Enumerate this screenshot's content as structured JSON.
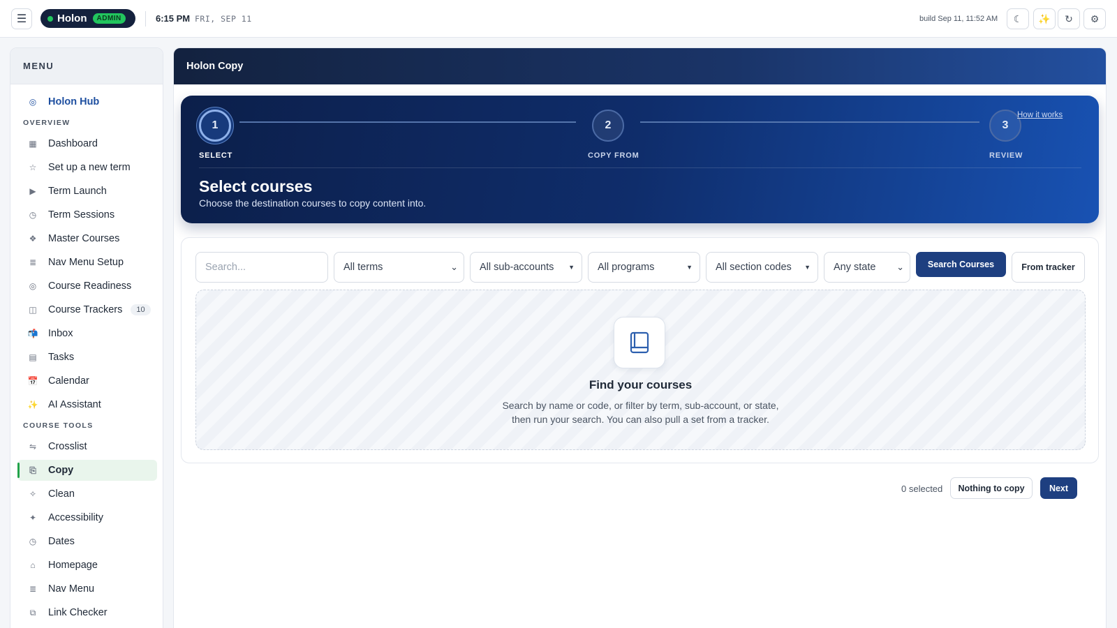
{
  "topbar": {
    "menu_icon": "hamburger-icon",
    "brand": "Holon",
    "badge": "ADMIN",
    "time": "6:15 PM",
    "date": "FRI, SEP 11",
    "build": "build Sep 11, 11:52 AM",
    "theme_icon": "☾",
    "sparkle_icon": "✨",
    "refresh_icon": "↻",
    "settings_icon": "⚙"
  },
  "sidebar": {
    "heading": "MENU",
    "hub": {
      "icon": "◎",
      "label": "Holon Hub"
    },
    "overview_label": "OVERVIEW",
    "overview": [
      {
        "icon": "▦",
        "label": "Dashboard"
      },
      {
        "icon": "☆",
        "label": "Set up a new term"
      },
      {
        "icon": "▶",
        "label": "Term Launch"
      },
      {
        "icon": "◷",
        "label": "Term Sessions"
      },
      {
        "icon": "❖",
        "label": "Master Courses"
      },
      {
        "icon": "≣",
        "label": "Nav Menu Setup"
      },
      {
        "icon": "◎",
        "label": "Course Readiness"
      },
      {
        "icon": "◫",
        "label": "Course Trackers",
        "count": "10"
      },
      {
        "icon": "📬",
        "label": "Inbox"
      },
      {
        "icon": "▤",
        "label": "Tasks"
      },
      {
        "icon": "📅",
        "label": "Calendar"
      },
      {
        "icon": "✨",
        "label": "AI Assistant"
      }
    ],
    "tools_label": "COURSE TOOLS",
    "tools": [
      {
        "icon": "⇋",
        "label": "Crosslist"
      },
      {
        "icon": "⎘",
        "label": "Copy"
      },
      {
        "icon": "✧",
        "label": "Clean"
      },
      {
        "icon": "✦",
        "label": "Accessibility"
      },
      {
        "icon": "◷",
        "label": "Dates"
      },
      {
        "icon": "⌂",
        "label": "Homepage"
      },
      {
        "icon": "≣",
        "label": "Nav Menu"
      },
      {
        "icon": "⧉",
        "label": "Link Checker"
      }
    ]
  },
  "main": {
    "title": "Holon Copy",
    "steps": [
      {
        "number": "1",
        "label": "SELECT"
      },
      {
        "number": "2",
        "label": "COPY FROM"
      },
      {
        "number": "3",
        "label": "REVIEW"
      }
    ],
    "how_it_works": "How it works",
    "step_title": "Select courses",
    "step_subtitle": "Choose the destination courses to copy content into.",
    "filters": {
      "search_placeholder": "Search...",
      "terms": "All terms",
      "subaccounts": "All sub-accounts",
      "programs": "All programs",
      "section_codes": "All section codes",
      "state": "Any state"
    },
    "search_button": "Search Courses",
    "tracker_button": "From tracker",
    "empty": {
      "icon": "book-icon",
      "title": "Find your courses",
      "line1": "Search by name or code, or filter by term, sub-account, or state,",
      "line2": "then run your search. You can also pull a set from a tracker."
    },
    "selected_text": "0 selected",
    "nothing_button": "Nothing to copy",
    "next_button": "Next"
  }
}
